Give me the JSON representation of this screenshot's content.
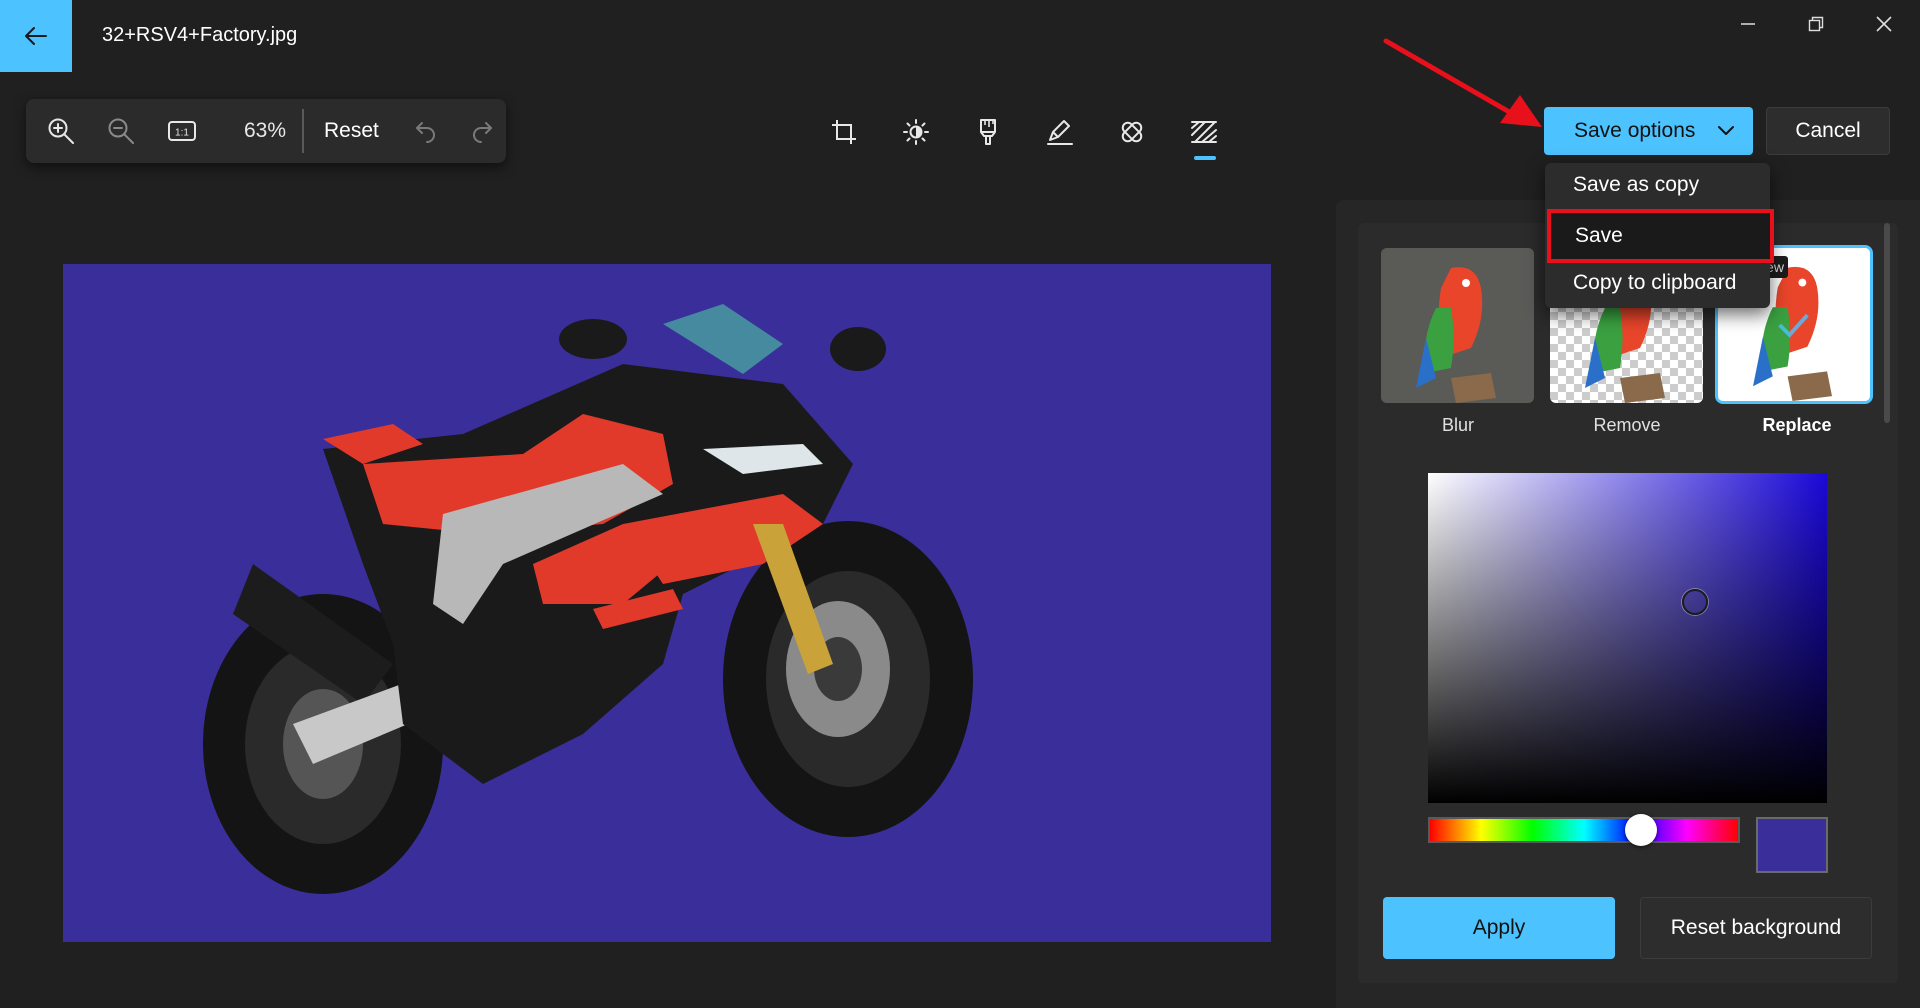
{
  "title_bar": {
    "file_name": "32+RSV4+Factory.jpg",
    "back_icon": "arrow-left-icon",
    "window_controls": [
      "minimize-icon",
      "restore-icon",
      "close-icon"
    ]
  },
  "left_toolbar": {
    "zoom_in_icon": "zoom-in-icon",
    "zoom_out_icon": "zoom-out-icon",
    "actual_size_icon": "actual-size-icon",
    "actual_size_glyph": "1:1",
    "zoom_value": "63%",
    "reset_label": "Reset",
    "undo_icon": "undo-icon",
    "redo_icon": "redo-icon"
  },
  "edit_tools": [
    {
      "name": "crop-icon"
    },
    {
      "name": "adjustment-icon"
    },
    {
      "name": "filter-icon"
    },
    {
      "name": "markup-icon"
    },
    {
      "name": "retouch-icon"
    },
    {
      "name": "background-icon",
      "active": true
    }
  ],
  "actions": {
    "save_options_label": "Save options",
    "cancel_label": "Cancel"
  },
  "save_menu": {
    "items": [
      "Save as copy",
      "Save",
      "Copy to clipboard"
    ],
    "highlighted": "Save"
  },
  "tooltip_fragment": "ew",
  "background_panel": {
    "options": [
      {
        "label": "Blur"
      },
      {
        "label": "Remove"
      },
      {
        "label": "Replace",
        "selected": true
      }
    ],
    "selected_color": "#3a2e9a",
    "hue_color": "#1a08d8",
    "apply_label": "Apply",
    "reset_background_label": "Reset background"
  },
  "colors": {
    "accent": "#4cc2ff",
    "highlight_red": "#e8101a",
    "canvas_background": "#3a2e9a"
  }
}
